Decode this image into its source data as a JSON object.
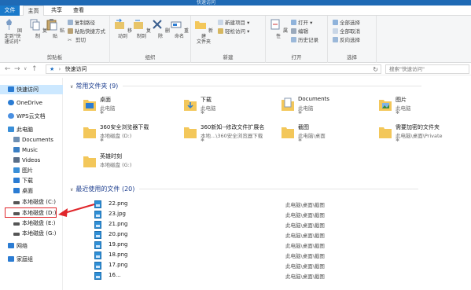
{
  "window": {
    "title": "快速访问"
  },
  "tabs": [
    "文件",
    "主页",
    "共享",
    "查看"
  ],
  "ribbon": {
    "pin_label": "固定到\"快\n速访问\"",
    "copy_label": "复制",
    "paste_label": "粘贴",
    "copy_path": "复制路径",
    "paste_shortcut": "粘贴快捷方式",
    "cut": "剪切",
    "clipboard_group": "剪贴板",
    "move_to": "移动到",
    "copy_to": "复制到",
    "delete": "删除",
    "rename": "重命名",
    "organize_group": "组织",
    "new_folder": "新建\n文件夹",
    "new_item": "新建项目",
    "easy_access": "轻松访问",
    "new_group": "新建",
    "properties": "属性",
    "open": "打开",
    "edit": "编辑",
    "history": "历史记录",
    "open_group": "打开",
    "select_all": "全部选择",
    "select_none": "全部取消",
    "invert": "反向选择",
    "select_group": "选择"
  },
  "address": {
    "path": "快速访问",
    "search_placeholder": "搜索\"快速访问\""
  },
  "sidebar": {
    "items": [
      {
        "label": "快速访问",
        "icon": "star-icon",
        "color": "#2b7cd3"
      },
      {
        "label": "OneDrive",
        "icon": "cloud-icon",
        "color": "#2b7cd3"
      },
      {
        "label": "WPS云文档",
        "icon": "cloud-icon",
        "color": "#4a90e2"
      },
      {
        "label": "此电脑",
        "icon": "computer-icon",
        "color": "#3a8fd8"
      },
      {
        "label": "Documents",
        "icon": "documents-icon",
        "color": "#6e8fb3"
      },
      {
        "label": "Music",
        "icon": "music-icon",
        "color": "#3b7fc4"
      },
      {
        "label": "Videos",
        "icon": "video-icon",
        "color": "#5a6e88"
      },
      {
        "label": "图片",
        "icon": "pictures-icon",
        "color": "#3a8fd8"
      },
      {
        "label": "下载",
        "icon": "download-icon",
        "color": "#2b7cd3"
      },
      {
        "label": "桌面",
        "icon": "desktop-icon",
        "color": "#2b7cd3"
      },
      {
        "label": "本地磁盘 (C:)",
        "icon": "drive-icon",
        "color": "#555555"
      },
      {
        "label": "本地磁盘 (D:)",
        "icon": "drive-icon",
        "color": "#555555"
      },
      {
        "label": "本地磁盘 (E:)",
        "icon": "drive-icon",
        "color": "#555555"
      },
      {
        "label": "本地磁盘 (G:)",
        "icon": "drive-icon",
        "color": "#555555"
      },
      {
        "label": "网络",
        "icon": "network-icon",
        "color": "#2b7cd3"
      },
      {
        "label": "家庭组",
        "icon": "homegroup-icon",
        "color": "#2b7cd3"
      }
    ]
  },
  "frequent": {
    "header": "常用文件夹 (9)",
    "folders": [
      {
        "name": "桌面",
        "sub": "此电脑"
      },
      {
        "name": "下载",
        "sub": "此电脑"
      },
      {
        "name": "Documents",
        "sub": "此电脑"
      },
      {
        "name": "图片",
        "sub": "此电脑"
      },
      {
        "name": "360安全浏览器下载",
        "sub": "本地磁盘 (D:)"
      },
      {
        "name": "360新知--修改文件扩展名",
        "sub": "本地...\\360安全浏览器下载"
      },
      {
        "name": "截图",
        "sub": "此电脑\\桌面"
      },
      {
        "name": "需要加密的文件夹",
        "sub": "此电脑\\桌面\\Private"
      },
      {
        "name": "英雄时刻",
        "sub": "本地磁盘 (G:)"
      }
    ]
  },
  "recent": {
    "header": "最近使用的文件 (20)",
    "files": [
      {
        "name": "22.png",
        "loc": "此电脑\\桌面\\截图"
      },
      {
        "name": "23.jpg",
        "loc": "此电脑\\桌面\\截图"
      },
      {
        "name": "21.png",
        "loc": "此电脑\\桌面\\截图"
      },
      {
        "name": "20.png",
        "loc": "此电脑\\桌面\\截图"
      },
      {
        "name": "19.png",
        "loc": "此电脑\\桌面\\截图"
      },
      {
        "name": "18.png",
        "loc": "此电脑\\桌面\\截图"
      },
      {
        "name": "17.png",
        "loc": "此电脑\\桌面\\截图"
      },
      {
        "name": "16...",
        "loc": "此电脑\\桌面\\截图"
      }
    ]
  },
  "colors": {
    "accent": "#1979ca",
    "folder": "#f3c75a",
    "highlight": "#e0262b"
  }
}
